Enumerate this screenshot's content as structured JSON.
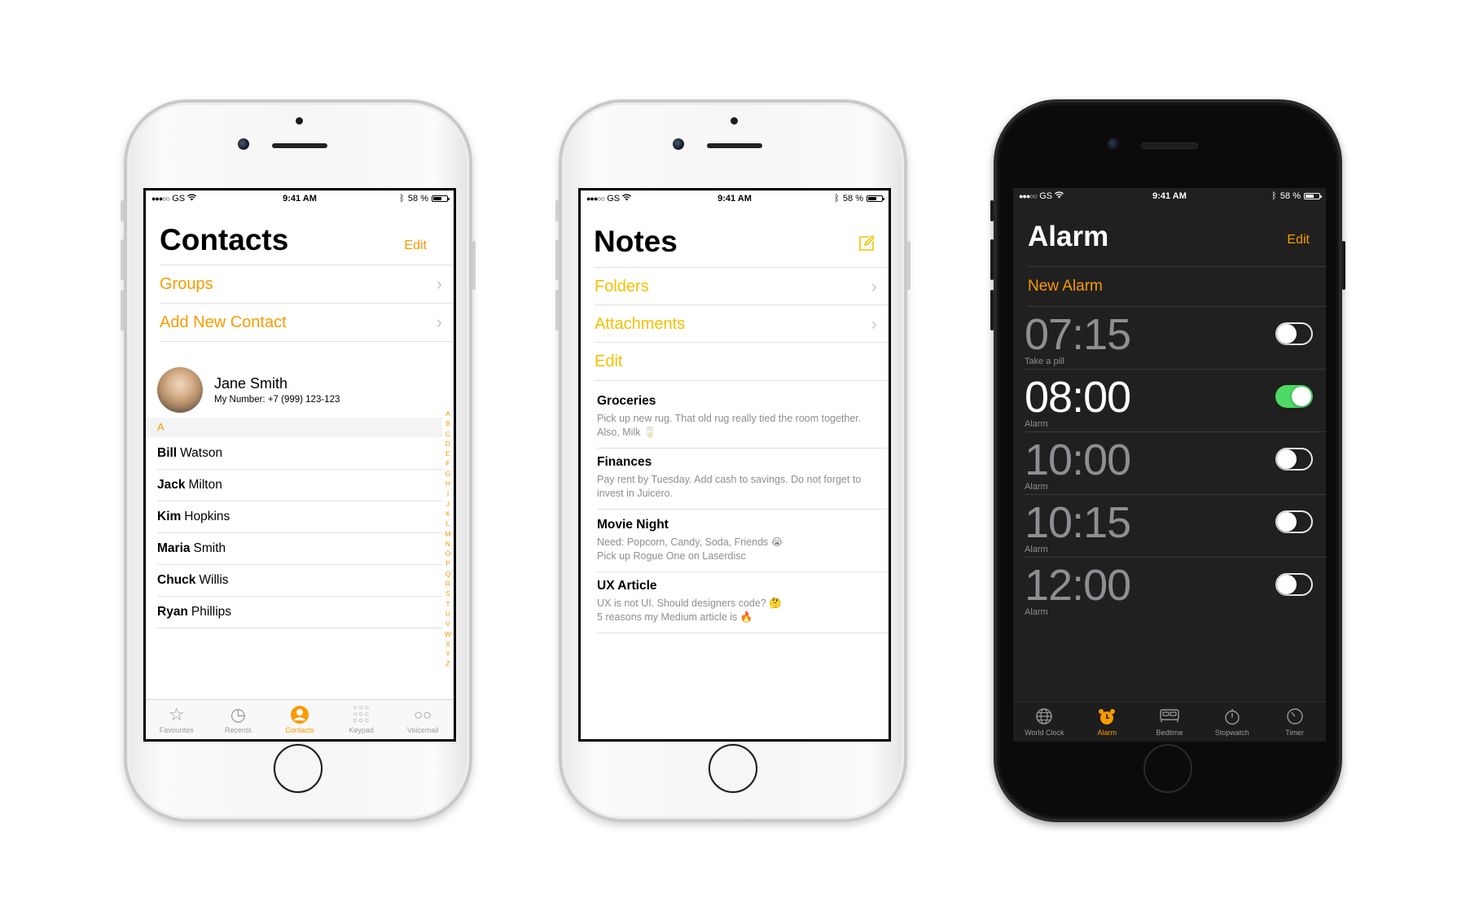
{
  "colors": {
    "ios_orange": "#fb9a00",
    "notes_yellow": "#f6c000",
    "switch_green": "#4cd964"
  },
  "status": {
    "carrier": "GS",
    "time": "9:41 AM",
    "battery": "58 %"
  },
  "contacts": {
    "title": "Contacts",
    "edit": "Edit",
    "links": [
      "Groups",
      "Add New Contact"
    ],
    "me": {
      "name": "Jane Smith",
      "number": "My Number:  +7 (999) 123-123"
    },
    "section": "A",
    "rows": [
      {
        "first": "Bill",
        "last": "Watson"
      },
      {
        "first": "Jack",
        "last": "Milton"
      },
      {
        "first": "Kim",
        "last": "Hopkins"
      },
      {
        "first": "Maria",
        "last": "Smith"
      },
      {
        "first": "Chuck",
        "last": "Willis"
      },
      {
        "first": "Ryan",
        "last": "Phillips"
      }
    ],
    "index": [
      "A",
      "B",
      "C",
      "D",
      "E",
      "F",
      "G",
      "H",
      "I",
      "J",
      "K",
      "L",
      "M",
      "N",
      "O",
      "P",
      "Q",
      "R",
      "S",
      "T",
      "U",
      "V",
      "W",
      "X",
      "Y",
      "Z"
    ],
    "tabs": [
      {
        "label": "Favourites",
        "icon": "star-icon"
      },
      {
        "label": "Recents",
        "icon": "clock-icon"
      },
      {
        "label": "Contacts",
        "icon": "person-icon"
      },
      {
        "label": "Keypad",
        "icon": "keypad-icon"
      },
      {
        "label": "Voicemail",
        "icon": "voicemail-icon"
      }
    ]
  },
  "notes": {
    "title": "Notes",
    "links": [
      "Folders",
      "Attachments",
      "Edit"
    ],
    "items": [
      {
        "title": "Groceries",
        "body": "Pick up new rug. That old rug really tied the room together. Also, Milk 🥛"
      },
      {
        "title": "Finances",
        "body": "Pay rent by Tuesday. Add cash to savings. Do not forget to invest in Juicero."
      },
      {
        "title": "Movie Night",
        "body": "Need: Popcorn, Candy, Soda, Friends 😭",
        "body2": "Pick up Rogue One on Laserdisc"
      },
      {
        "title": "UX Article",
        "body": "UX is not UI. Should designers code? 🤔",
        "body2": "5 reasons my Medium article is 🔥"
      }
    ]
  },
  "alarm": {
    "title": "Alarm",
    "edit": "Edit",
    "new": "New Alarm",
    "items": [
      {
        "time": "07:15",
        "label": "Take a pill",
        "on": false
      },
      {
        "time": "08:00",
        "label": "Alarm",
        "on": true
      },
      {
        "time": "10:00",
        "label": "Alarm",
        "on": false
      },
      {
        "time": "10:15",
        "label": "Alarm",
        "on": false
      },
      {
        "time": "12:00",
        "label": "Alarm",
        "on": false
      }
    ],
    "tabs": [
      {
        "label": "World Clock",
        "icon": "globe-icon"
      },
      {
        "label": "Alarm",
        "icon": "alarm-clock-icon"
      },
      {
        "label": "Bedtime",
        "icon": "bed-icon"
      },
      {
        "label": "Stopwatch",
        "icon": "stopwatch-icon"
      },
      {
        "label": "Timer",
        "icon": "timer-icon"
      }
    ]
  }
}
